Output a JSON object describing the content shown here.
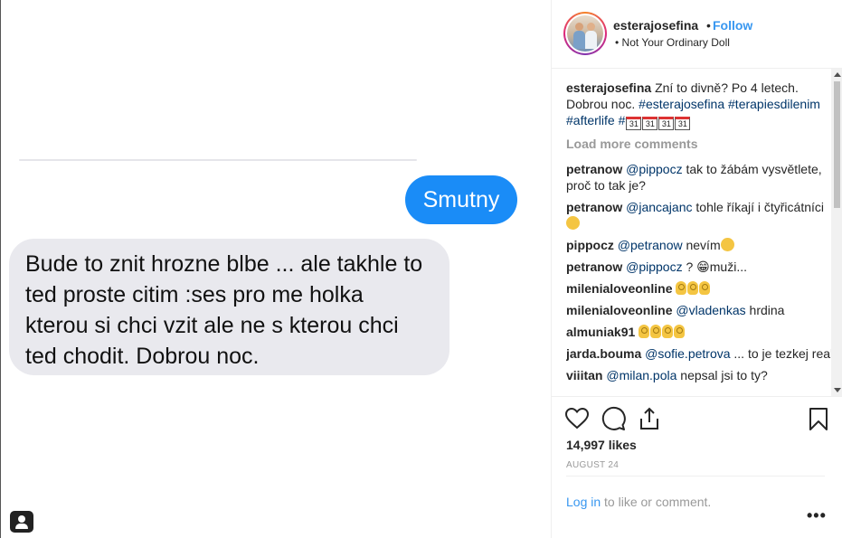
{
  "post": {
    "sent_message": "Smutny",
    "received_message_lines": [
      "Bude to znit hrozne blbe ... ale takhle to",
      "ted proste citim :ses pro me holka",
      "kterou si chci vzit ale ne s kterou chci",
      "ted chodit. Dobrou noc."
    ]
  },
  "header": {
    "username": "esterajosefina",
    "separator": "•",
    "follow_label": "Follow",
    "location": "Not Your Ordinary Doll"
  },
  "caption": {
    "username": "esterajosefina",
    "text": "Zní to divně? Po 4 letech. Dobrou noc.",
    "hashtags": [
      "#esterajosefina",
      "#terapiesdilenim",
      "#afterlife",
      "#"
    ],
    "calendar_emoji_text": "31"
  },
  "load_more_label": "Load more comments",
  "comments": [
    {
      "user": "petranow",
      "mention": "@pippocz",
      "text": "tak to žábám vysvětlete, proč to tak je?"
    },
    {
      "user": "petranow",
      "mention": "@jancajanc",
      "text": "tohle říkají i čtyřicátníci"
    },
    {
      "user": "pippocz",
      "mention": "@petranow",
      "text": "nevím"
    },
    {
      "user": "petranow",
      "mention": "@pippocz",
      "text": "? 😁muži..."
    },
    {
      "user": "milenialoveonline",
      "mention": "",
      "text": ""
    },
    {
      "user": "milenialoveonline",
      "mention": "@vladenkas",
      "text": "hrdina"
    },
    {
      "user": "almuniak91",
      "mention": "",
      "text": ""
    },
    {
      "user": "jarda.bouma",
      "mention": "@sofie.petrova",
      "text": "... to je tezkej real"
    },
    {
      "user": "viiitan",
      "mention": "@milan.pola",
      "text": "nepsal jsi to ty?"
    }
  ],
  "likes": "14,997 likes",
  "date": "AUGUST 24",
  "login": {
    "link": "Log in",
    "text": " to like or comment."
  },
  "more_label": "•••",
  "colors": {
    "accent": "#3897f0",
    "bubble_blue": "#1a8cf7",
    "bubble_gray": "#e9e9ee"
  }
}
